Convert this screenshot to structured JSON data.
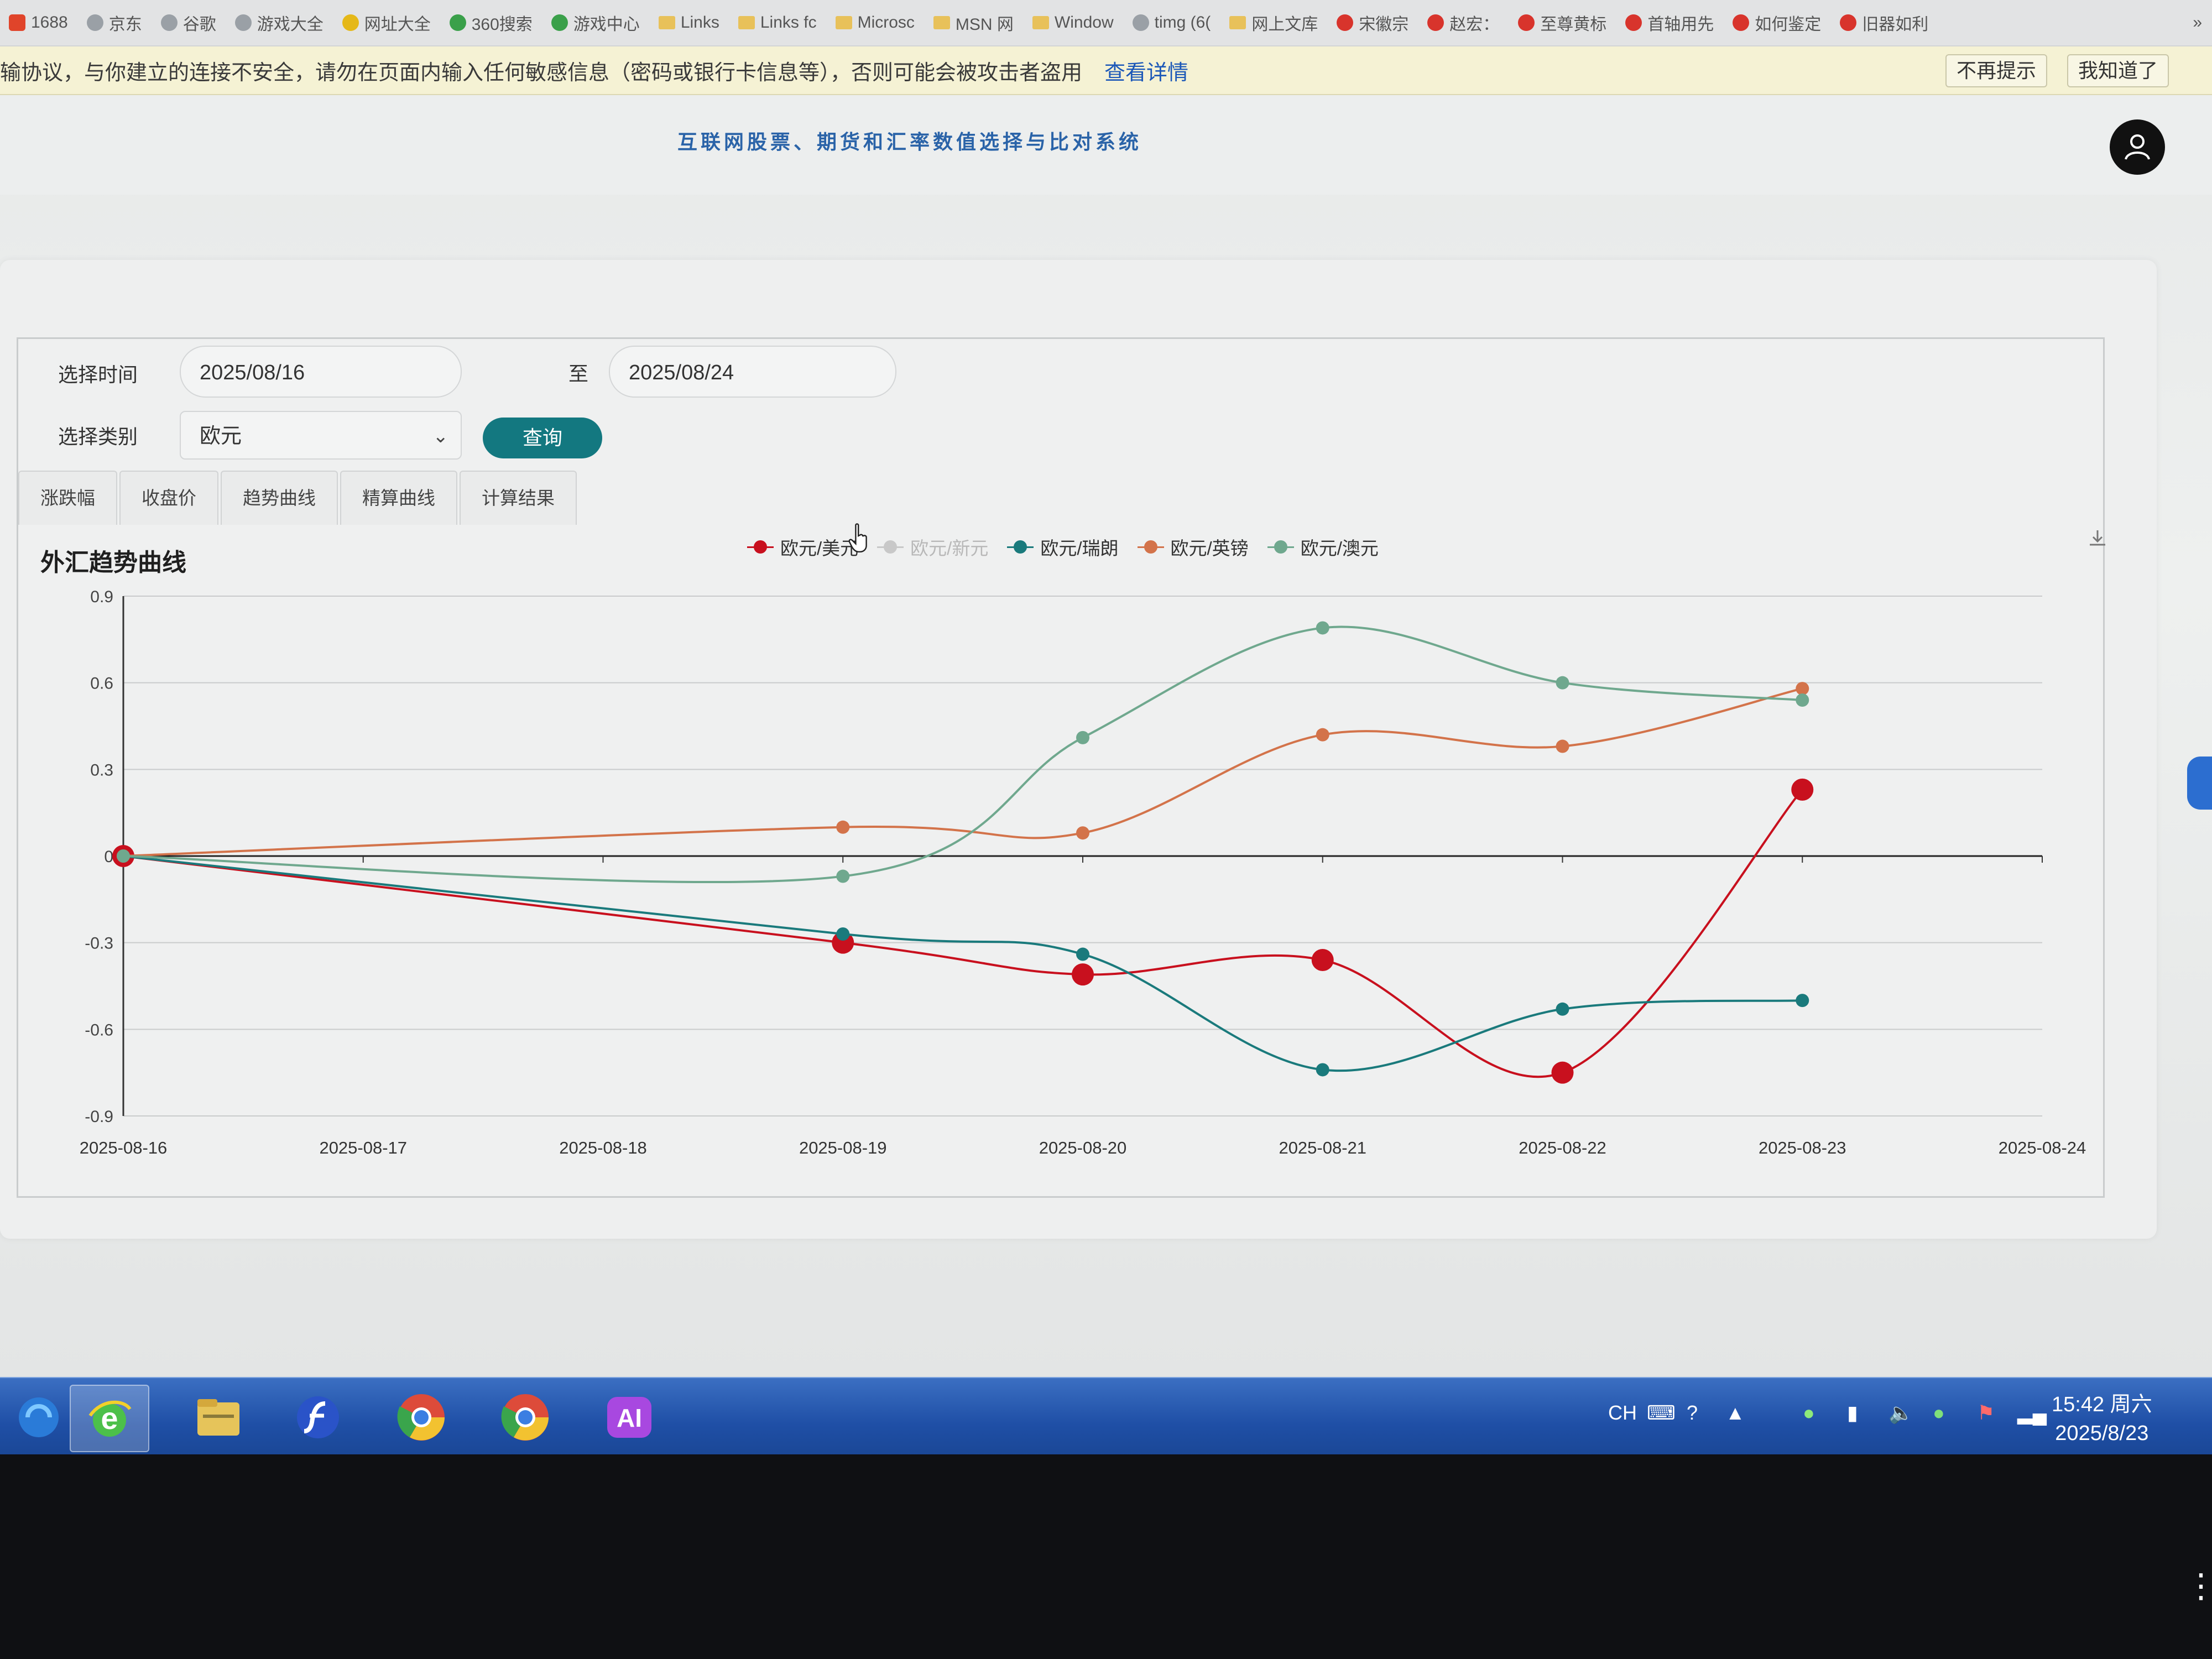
{
  "bookmarks": [
    {
      "label": "1688",
      "icon": "red"
    },
    {
      "label": "京东",
      "icon": "globe"
    },
    {
      "label": "谷歌",
      "icon": "globe"
    },
    {
      "label": "游戏大全",
      "icon": "globe"
    },
    {
      "label": "网址大全",
      "icon": "yellow"
    },
    {
      "label": "360搜索",
      "icon": "green"
    },
    {
      "label": "游戏中心",
      "icon": "green"
    },
    {
      "label": "Links",
      "icon": "folder"
    },
    {
      "label": "Links fc",
      "icon": "folder"
    },
    {
      "label": "Microsc",
      "icon": "folder"
    },
    {
      "label": "MSN 网",
      "icon": "folder"
    },
    {
      "label": "Window",
      "icon": "folder"
    },
    {
      "label": "timg (6(",
      "icon": "globe"
    },
    {
      "label": "网上文库",
      "icon": "folder"
    },
    {
      "label": "宋徽宗",
      "icon": "weibo"
    },
    {
      "label": "赵宏：",
      "icon": "weibo"
    },
    {
      "label": "至尊黄标",
      "icon": "weibo"
    },
    {
      "label": "首轴用先",
      "icon": "weibo"
    },
    {
      "label": "如何鉴定",
      "icon": "weibo"
    },
    {
      "label": "旧器如利",
      "icon": "weibo"
    }
  ],
  "bookmarks_overflow": "»",
  "warning": {
    "message": "输协议，与你建立的连接不安全，请勿在页面内输入任何敏感信息（密码或银行卡信息等），否则可能会被攻击者盗用",
    "details_link": "查看详情",
    "dismiss_forever": "不再提示",
    "acknowledge": "我知道了"
  },
  "header": {
    "title": "互联网股票、期货和汇率数值选择与比对系统"
  },
  "filters": {
    "time_label": "选择时间",
    "start_date": "2025/08/16",
    "to_label": "至",
    "end_date": "2025/08/24",
    "category_label": "选择类别",
    "category_value": "欧元",
    "query_button": "查询"
  },
  "tabs": [
    "涨跌幅",
    "收盘价",
    "趋势曲线",
    "精算曲线",
    "计算结果"
  ],
  "chart_data": {
    "type": "line",
    "title": "外汇趋势曲线",
    "categories": [
      "2025-08-16",
      "2025-08-17",
      "2025-08-18",
      "2025-08-19",
      "2025-08-20",
      "2025-08-21",
      "2025-08-22",
      "2025-08-23",
      "2025-08-24"
    ],
    "yticks": [
      "0.9",
      "0.6",
      "0.3",
      "0",
      "-0.3",
      "-0.6",
      "-0.9"
    ],
    "ylim": [
      -0.9,
      0.9
    ],
    "smooth": true,
    "legend_position": "top-center",
    "series": [
      {
        "name": "欧元/美元",
        "color": "#c8101e",
        "visible": true,
        "points": [
          [
            0,
            0
          ],
          [
            3,
            -0.3
          ],
          [
            4,
            -0.41
          ],
          [
            5,
            -0.36
          ],
          [
            6,
            -0.75
          ],
          [
            7,
            0.23
          ]
        ]
      },
      {
        "name": "欧元/新元",
        "color": "#b8b8b8",
        "visible": false,
        "points": []
      },
      {
        "name": "欧元/瑞朗",
        "color": "#1a7a7c",
        "visible": true,
        "points": [
          [
            0,
            0
          ],
          [
            3,
            -0.27
          ],
          [
            4,
            -0.34
          ],
          [
            5,
            -0.74
          ],
          [
            6,
            -0.53
          ],
          [
            7,
            -0.5
          ]
        ]
      },
      {
        "name": "欧元/英镑",
        "color": "#d3734a",
        "visible": true,
        "points": [
          [
            0,
            0
          ],
          [
            3,
            0.1
          ],
          [
            4,
            0.08
          ],
          [
            5,
            0.42
          ],
          [
            6,
            0.38
          ],
          [
            7,
            0.58
          ]
        ]
      },
      {
        "name": "欧元/澳元",
        "color": "#6fa88e",
        "visible": true,
        "points": [
          [
            0,
            0
          ],
          [
            3,
            -0.07
          ],
          [
            4,
            0.41
          ],
          [
            5,
            0.79
          ],
          [
            6,
            0.6
          ],
          [
            7,
            0.54
          ]
        ]
      }
    ]
  },
  "taskbar": {
    "apps": [
      "ie-legacy-icon",
      "ie-icon",
      "file-explorer-icon",
      "flash-icon",
      "chrome-icon",
      "chrome-icon-2",
      "ai-app-icon"
    ],
    "lang": "CH",
    "time": "15:42 周六",
    "date": "2025/8/23"
  }
}
